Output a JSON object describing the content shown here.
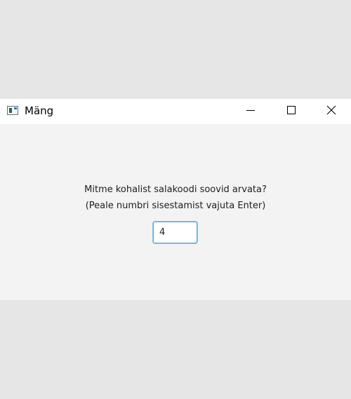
{
  "window": {
    "title": "Mäng",
    "controls": {
      "minimize": "minimize-icon",
      "maximize": "maximize-icon",
      "close": "close-icon"
    }
  },
  "dialog": {
    "question": "Mitme kohalist salakoodi soovid arvata?",
    "instruction": "(Peale numbri sisestamist vajuta Enter)",
    "input_value": "4"
  },
  "colors": {
    "desktop": "#e6e6e6",
    "window_bg": "#f3f3f3",
    "titlebar_bg": "#ffffff",
    "focus_border": "#5aa7dc"
  }
}
